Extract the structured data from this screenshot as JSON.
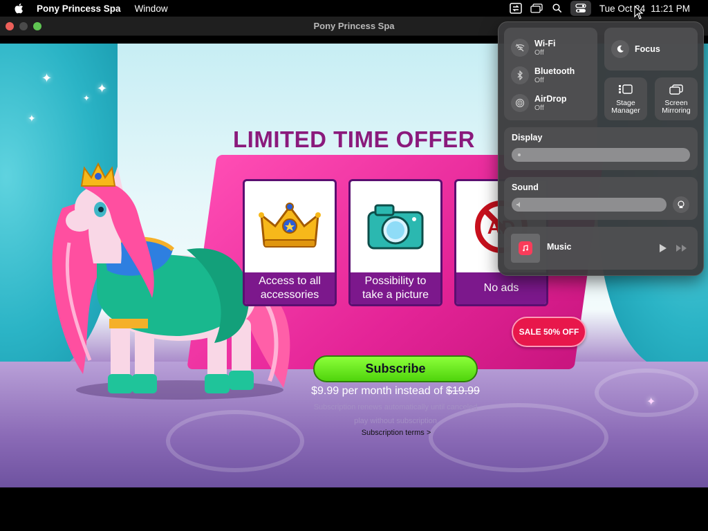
{
  "menubar": {
    "apple": "apple-logo",
    "app_name": "Pony Princess Spa",
    "menu_window": "Window",
    "clock_date": "Tue Oct 24",
    "clock_time": "11:21 PM"
  },
  "window": {
    "title": "Pony Princess Spa"
  },
  "offer": {
    "title": "LIMITED TIME OFFER",
    "cards": [
      {
        "label": "Access to all accessories",
        "icon": "crown-icon"
      },
      {
        "label": "Possibility to take a picture",
        "icon": "camera-icon"
      },
      {
        "label": "No ads",
        "icon": "no-ads-icon",
        "icon_text": "AD"
      }
    ],
    "sale_badge": "SALE 50% OFF",
    "subscribe_label": "Subscribe",
    "price_new": "$9.99",
    "price_text": " per month instead of ",
    "price_old": "$19.99",
    "fineprint_1": "Subscription renews automatically until canceled",
    "fineprint_2": "play without subscription",
    "terms_link": "Subscription terms >"
  },
  "control_center": {
    "wifi": {
      "name": "Wi-Fi",
      "state": "Off"
    },
    "bluetooth": {
      "name": "Bluetooth",
      "state": "Off"
    },
    "airdrop": {
      "name": "AirDrop",
      "state": "Off"
    },
    "focus": "Focus",
    "stage_manager_1": "Stage",
    "stage_manager_2": "Manager",
    "screen_mirroring_1": "Screen",
    "screen_mirroring_2": "Mirroring",
    "display_label": "Display",
    "sound_label": "Sound",
    "music_label": "Music"
  },
  "colors": {
    "title": "#8a1a7c",
    "panel": "#e42497",
    "card_label_bg": "#7c188c",
    "subscribe": "#4fd40c",
    "sale": "#e8174b"
  }
}
